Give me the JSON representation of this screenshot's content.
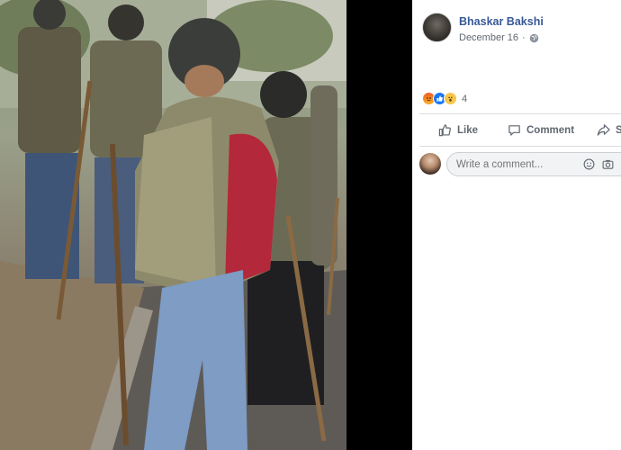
{
  "post": {
    "author": "Bhaskar Bakshi",
    "date": "December 16",
    "privacy_icon": "globe-icon",
    "reaction_icons": [
      "angry-reaction-icon",
      "like-reaction-icon",
      "wow-reaction-icon"
    ],
    "reaction_count": "4",
    "photo_description": "Men in camouflage vests and helmets holding long wooden sticks on a street"
  },
  "actions": {
    "like": "Like",
    "comment": "Comment",
    "share": "S"
  },
  "comment_box": {
    "placeholder": "Write a comment..."
  },
  "colors": {
    "link": "#385898",
    "muted": "#606770",
    "divider": "#dadde1",
    "like_blue": "#1877f2",
    "gutter": "#000000"
  }
}
